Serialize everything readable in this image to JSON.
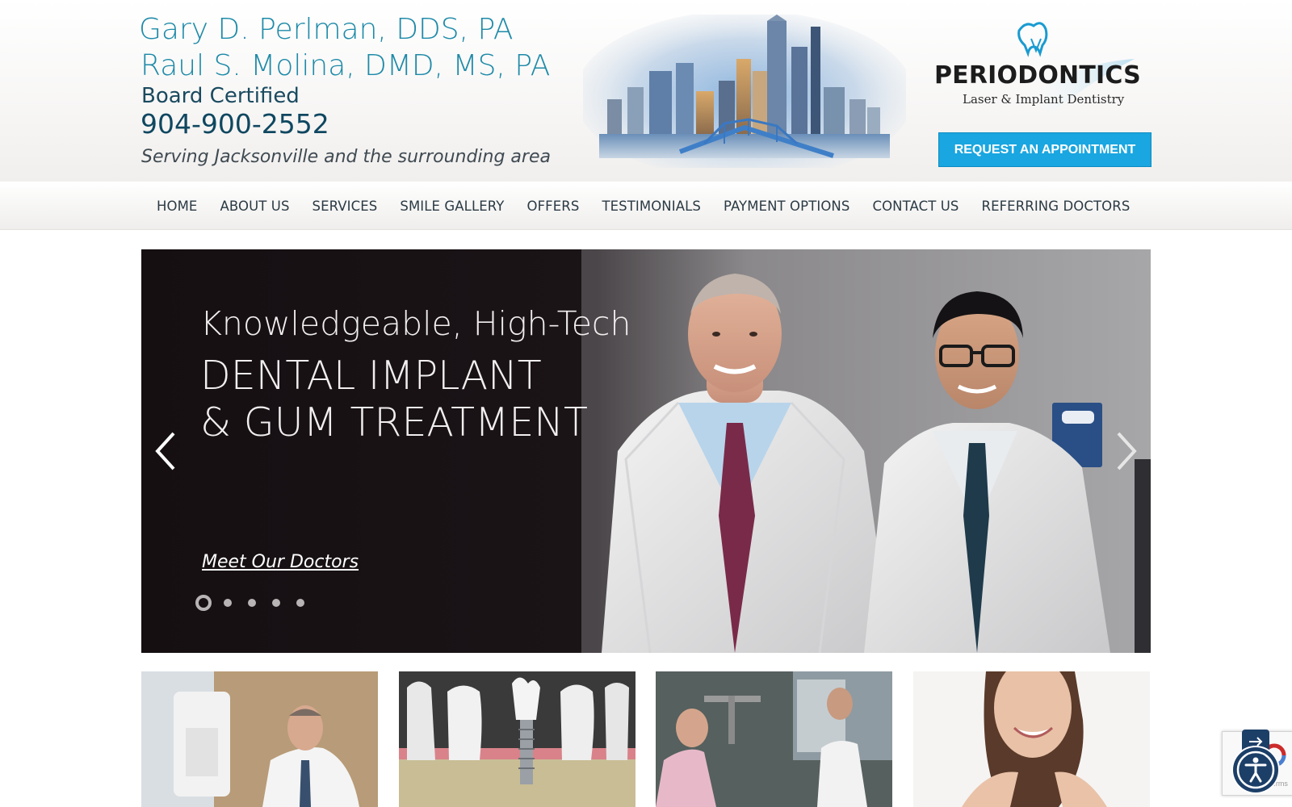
{
  "header": {
    "name1": "Gary D. Perlman, DDS, PA",
    "name2": "Raul S. Molina, DMD, MS, PA",
    "board": "Board Certified",
    "phone": "904-900-2552",
    "serving": "Serving Jacksonville and the surrounding area",
    "logo_word": "PERIODONTICS",
    "logo_sub": "Laser & Implant Dentistry",
    "appointment_button": "REQUEST AN APPOINTMENT"
  },
  "nav": {
    "items": [
      "HOME",
      "ABOUT US",
      "SERVICES",
      "SMILE GALLERY",
      "OFFERS",
      "TESTIMONIALS",
      "PAYMENT OPTIONS",
      "CONTACT US",
      "REFERRING DOCTORS"
    ]
  },
  "hero": {
    "line1": "Knowledgeable, High-Tech",
    "line2": "DENTAL IMPLANT",
    "line3": "& GUM TREATMENT",
    "link": "Meet Our Doctors",
    "slide_count": 5,
    "active_slide": 1
  },
  "recaptcha": {
    "text": "Privacy - Terms"
  },
  "colors": {
    "brand_teal": "#1e8aa8",
    "button_blue": "#1aa6e0",
    "nav_text": "#2b3a44",
    "hero_bg": "#150f12",
    "accessibility_navy": "#1c3f68"
  },
  "icons": {
    "prev": "chevron-left-icon",
    "next": "chevron-right-icon",
    "accessibility": "accessibility-icon",
    "skip": "arrow-right-icon"
  }
}
